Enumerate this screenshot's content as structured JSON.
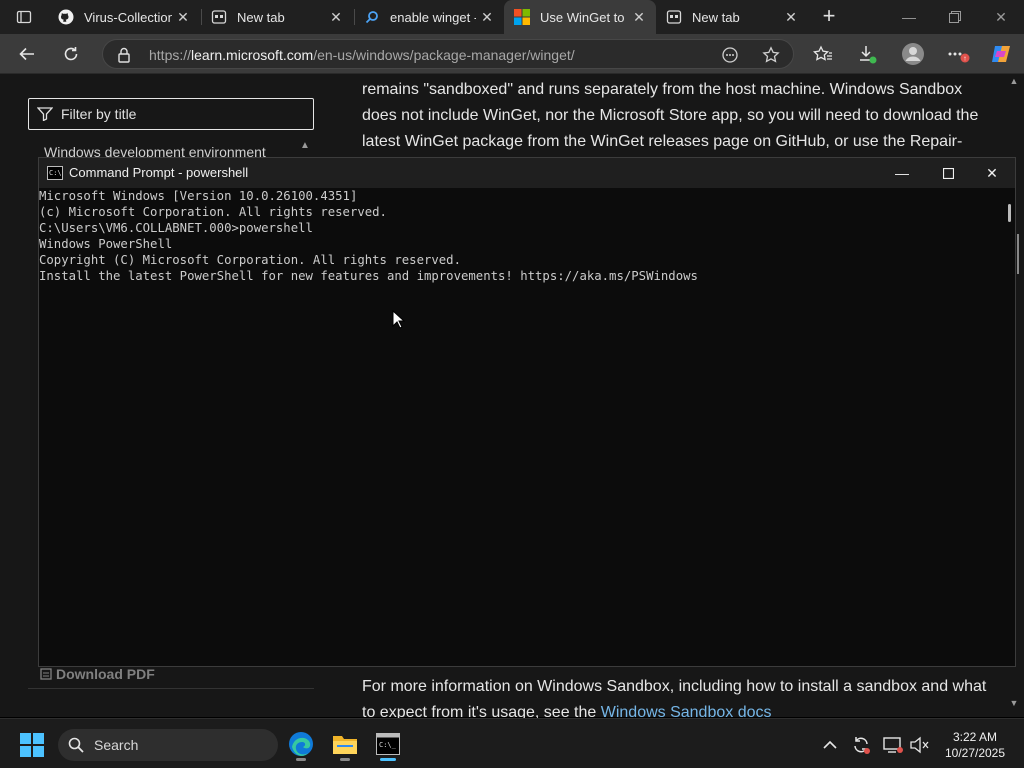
{
  "browser": {
    "tabs": [
      {
        "title": "Virus-Collection/",
        "icon": "github-icon",
        "active": false
      },
      {
        "title": "New tab",
        "icon": "newtab-icon",
        "active": false
      },
      {
        "title": "enable winget - S",
        "icon": "search-icon",
        "active": false
      },
      {
        "title": "Use WinGet to in",
        "icon": "microsoft-logo-icon",
        "active": true
      },
      {
        "title": "New tab",
        "icon": "newtab-icon",
        "active": false
      }
    ],
    "url_prefix": "https://",
    "url_host": "learn.microsoft.com",
    "url_path": "/en-us/windows/package-manager/winget/"
  },
  "sidebar": {
    "filter_placeholder": "Filter by title",
    "toc_item": "Windows development environment",
    "download_pdf": "Download PDF"
  },
  "article": {
    "p1": "remains \"sandboxed\" and runs separately from the host machine. Windows Sandbox does not include WinGet, nor the Microsoft Store app, so you will need to download the latest WinGet package from the WinGet releases page on GitHub, or use the Repair-",
    "p2_text": "For more information on Windows Sandbox, including how to install a sandbox and what to expect from it's usage, see the ",
    "p2_link": "Windows Sandbox docs"
  },
  "cmd": {
    "title": "Command Prompt - powershell",
    "lines": [
      "Microsoft Windows [Version 10.0.26100.4351]",
      "(c) Microsoft Corporation. All rights reserved.",
      "",
      "C:\\Users\\VM6.COLLABNET.000>powershell",
      "Windows PowerShell",
      "Copyright (C) Microsoft Corporation. All rights reserved.",
      "",
      "Install the latest PowerShell for new features and improvements! https://aka.ms/PSWindows",
      ""
    ]
  },
  "taskbar": {
    "search_label": "Search",
    "time": "3:22 AM",
    "date": "10/27/2025"
  },
  "colors": {
    "accent": "#4cc2ff",
    "link": "#75b6e7",
    "page_bg": "#171717",
    "console_bg": "#0c0c0c"
  }
}
